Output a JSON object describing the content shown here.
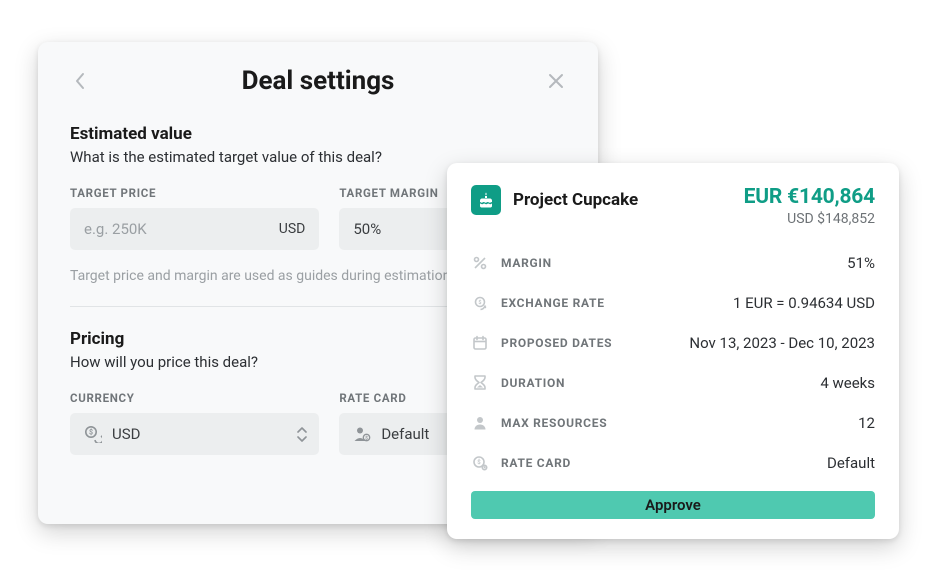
{
  "settings": {
    "title": "Deal settings",
    "sections": {
      "estimated": {
        "title": "Estimated value",
        "sub": "What is the estimated target value of this deal?",
        "target_price": {
          "label": "TARGET PRICE",
          "placeholder": "e.g. 250K",
          "currency_suffix": "USD"
        },
        "target_margin": {
          "label": "TARGET MARGIN",
          "value": "50%"
        },
        "help": "Target price and margin are used as guides during estimation."
      },
      "pricing": {
        "title": "Pricing",
        "sub": "How will you price this deal?",
        "currency": {
          "label": "CURRENCY",
          "value": "USD"
        },
        "rate_card": {
          "label": "RATE CARD",
          "value": "Default"
        }
      }
    }
  },
  "summary": {
    "project_name": "Project Cupcake",
    "amount_primary": "EUR €140,864",
    "amount_secondary": "USD $148,852",
    "rows": {
      "margin": {
        "label": "MARGIN",
        "value": "51%"
      },
      "exchange_rate": {
        "label": "EXCHANGE RATE",
        "value": "1 EUR = 0.94634 USD"
      },
      "proposed_dates": {
        "label": "PROPOSED DATES",
        "value": "Nov 13, 2023 - Dec 10, 2023"
      },
      "duration": {
        "label": "DURATION",
        "value": "4 weeks"
      },
      "max_resources": {
        "label": "MAX RESOURCES",
        "value": "12"
      },
      "rate_card": {
        "label": "RATE CARD",
        "value": "Default"
      }
    },
    "approve_label": "Approve"
  }
}
